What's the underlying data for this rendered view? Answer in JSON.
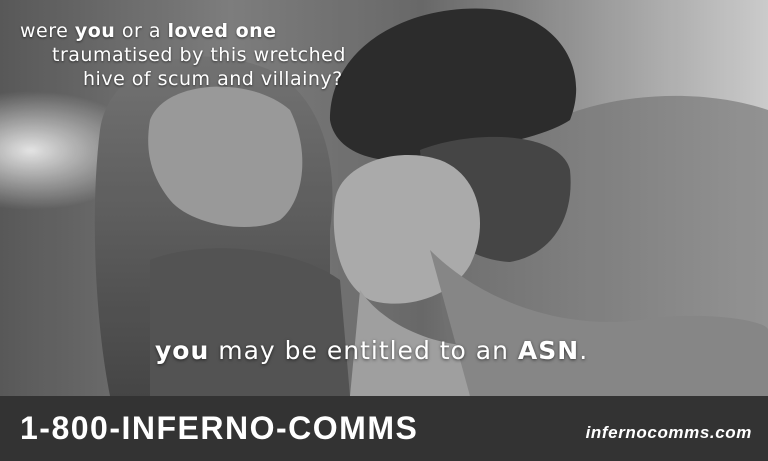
{
  "headline": {
    "line1": {
      "prefix": "were ",
      "em1": "you",
      "middle": " or a ",
      "em2": "loved one"
    },
    "line2": "traumatised by this wretched",
    "line3": "hive of scum and villainy?"
  },
  "tagline": {
    "em1": "you",
    "middle": " may be entitled to an ",
    "em2": "ASN",
    "suffix": "."
  },
  "footer": {
    "phone": "1-800-INFERNO-COMMS",
    "website": "infernocomms.com"
  },
  "colors": {
    "text": "#ffffff",
    "footer_bg": "#333333"
  },
  "photo": {
    "description_icon": "grayscale-photo"
  }
}
